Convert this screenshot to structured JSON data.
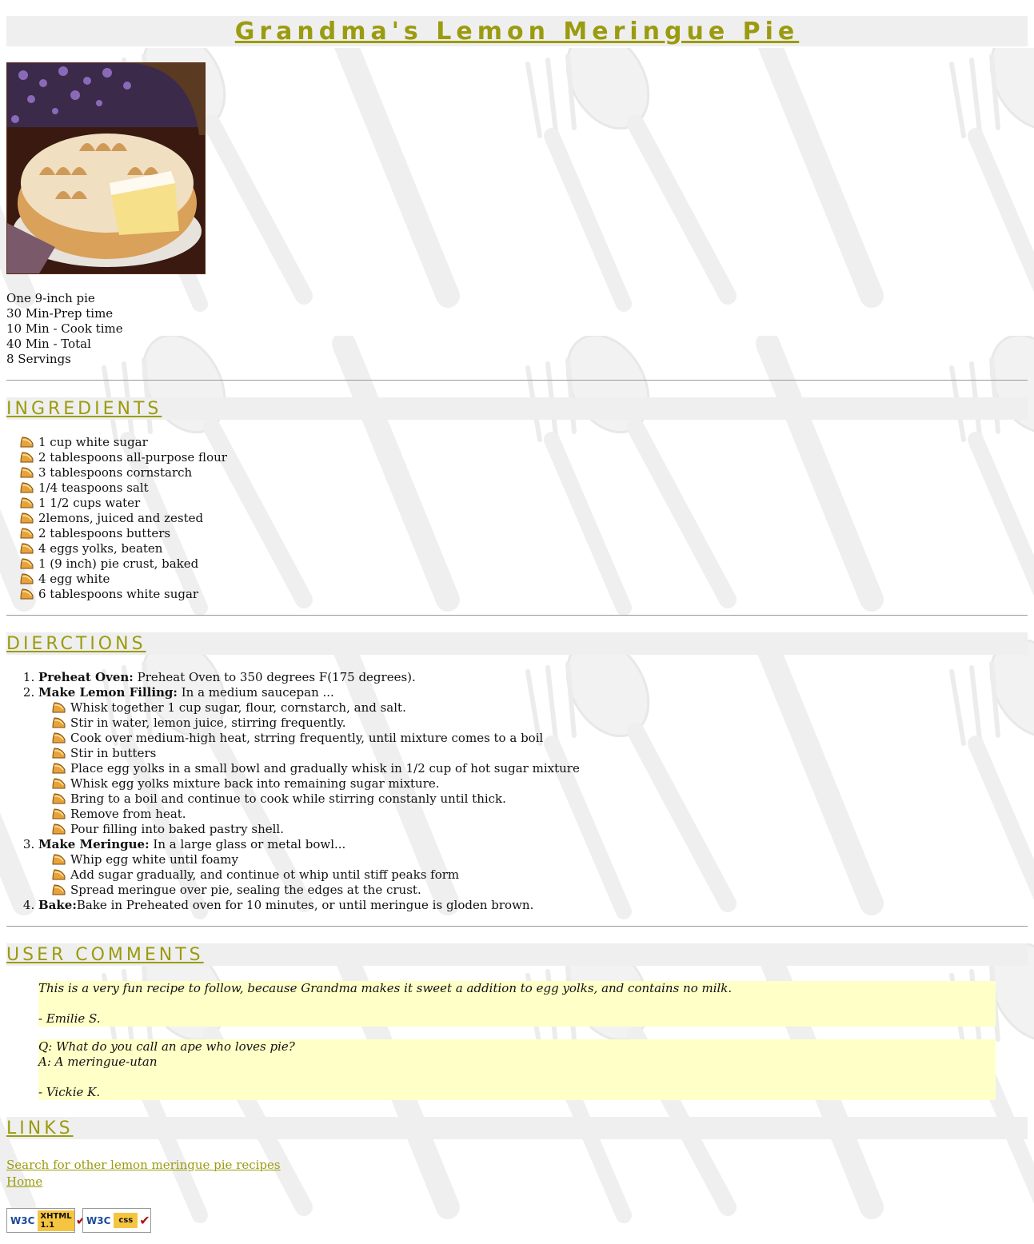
{
  "page": {
    "title": "Grandma's Lemon Meringue Pie"
  },
  "hero": {
    "alt": "Lemon meringue pie"
  },
  "meta": [
    "One 9-inch pie",
    "30 Min-Prep time",
    "10 Min - Cook time",
    "40 Min - Total",
    "8 Servings"
  ],
  "sections": {
    "ingredients": "INGREDIENTS",
    "directions": "DIERCTIONS",
    "comments": "USER COMMENTS",
    "links": "LINKS"
  },
  "ingredients": [
    "1 cup white sugar",
    "2 tablespoons all-purpose flour",
    "3 tablespoons cornstarch",
    "1/4 teaspoons salt",
    "1 1/2 cups water",
    "2lemons, juiced and zested",
    "2 tablespoons butters",
    "4 eggs yolks, beaten",
    "1 (9 inch) pie crust, baked",
    "4 egg white",
    "6 tablespoons white sugar"
  ],
  "directions": [
    {
      "label": "Preheat Oven:",
      "text": " Preheat Oven to 350 degrees F(175 degrees).",
      "steps": []
    },
    {
      "label": "Make Lemon Filling:",
      "text": " In a medium saucepan ...",
      "steps": [
        "Whisk together 1 cup sugar, flour, cornstarch, and salt.",
        "Stir in water, lemon juice, stirring frequently.",
        "Cook over medium-high heat, strring frequently, until mixture comes to a boil",
        "Stir in butters",
        "Place egg yolks in a small bowl and gradually whisk in 1/2 cup of hot sugar mixture",
        "Whisk egg yolks mixture back into remaining sugar mixture.",
        "Bring to a boil and continue to cook while stirring constanly until thick.",
        "Remove from heat.",
        "Pour filling into baked pastry shell."
      ]
    },
    {
      "label": "Make Meringue:",
      "text": " In a large glass or metal bowl...",
      "steps": [
        "Whip egg white until foamy",
        "Add sugar gradually, and continue ot whip until stiff peaks form",
        "Spread meringue over pie, sealing the edges at the crust."
      ]
    },
    {
      "label": "Bake:",
      "text": "Bake in Preheated oven for 10 minutes, or until meringue is gloden brown.",
      "steps": []
    }
  ],
  "comments": [
    {
      "lines": [
        "This is a very fun recipe to follow, because Grandma makes it sweet a addition to egg yolks, and contains no milk."
      ],
      "author": "- Emilie S."
    },
    {
      "lines": [
        "Q: What do you call an ape who loves pie?",
        "A: A meringue-utan"
      ],
      "author": "- Vickie K."
    }
  ],
  "links": [
    "Search for other lemon meringue pie recipes",
    "Home"
  ],
  "badges": {
    "xhtml_top": "XHTML",
    "xhtml_bottom": "1.1",
    "w3c": "W3C",
    "css": "css"
  },
  "colors": {
    "heading": "#9b9b10",
    "bar": "#efefef",
    "comment_bg": "#ffffc8"
  }
}
